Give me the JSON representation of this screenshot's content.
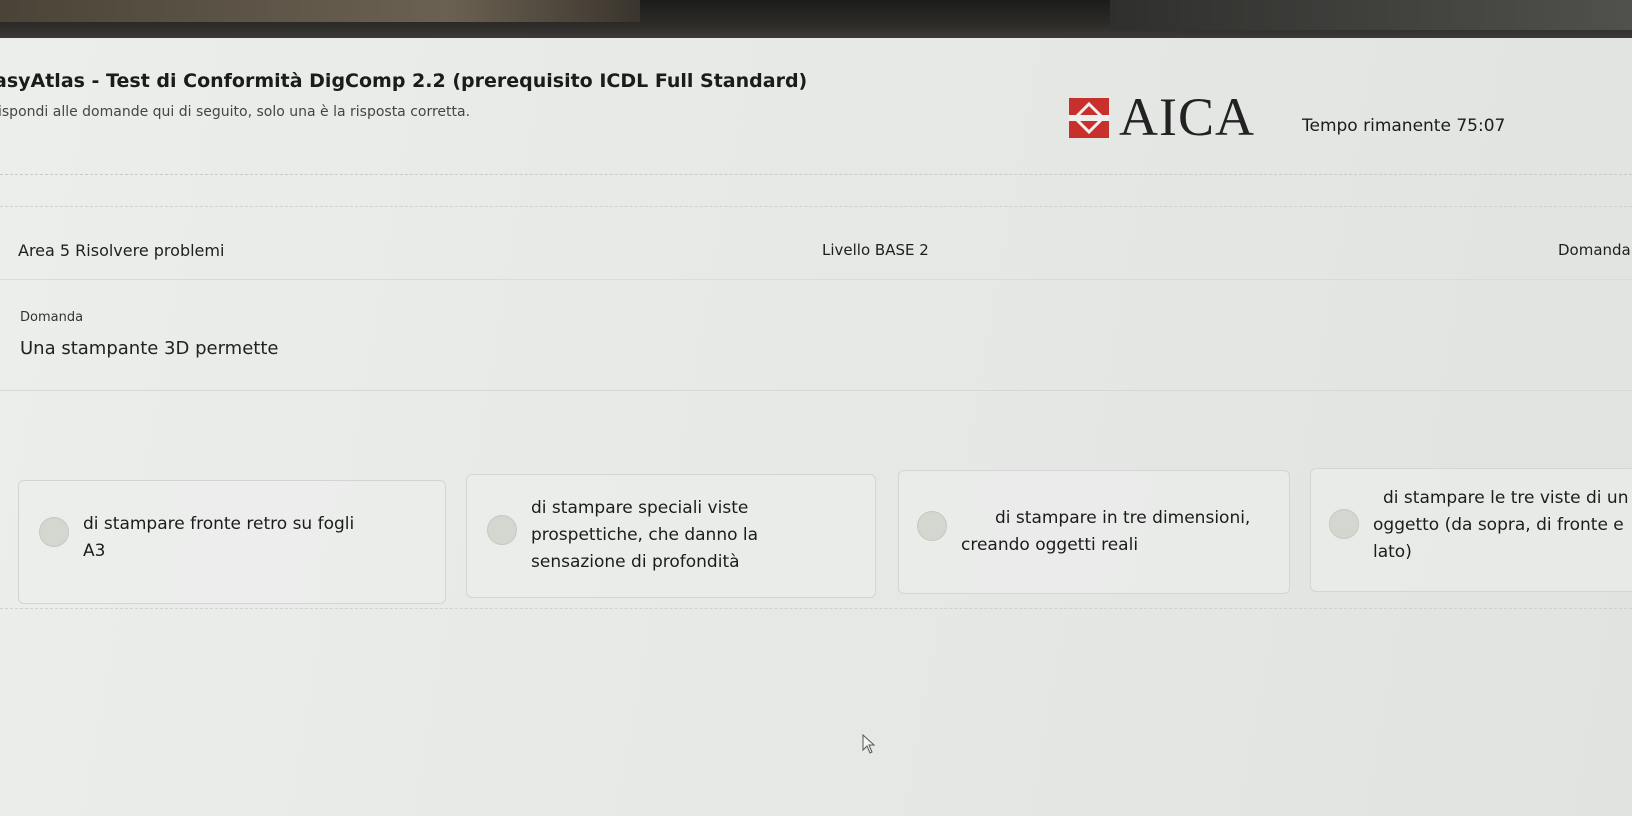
{
  "header": {
    "title": "asyAtlas - Test di Conformità DigComp 2.2 (prerequisito ICDL Full Standard)",
    "instructions": "ispondi alle domande qui di seguito, solo una è la risposta corretta.",
    "logo_text": "AICA",
    "timer_label": "Tempo rimanente",
    "timer_value": "75:07"
  },
  "info_bar": {
    "area": "Area 5 Risolvere problemi",
    "level": "Livello BASE 2",
    "question_counter": "Domanda"
  },
  "question": {
    "caption": "Domanda",
    "text": "Una stampante 3D permette"
  },
  "answers": [
    {
      "lines": [
        "di stampare fronte retro su fogli",
        "A3"
      ]
    },
    {
      "lines": [
        "di stampare speciali viste",
        "prospettiche, che danno la",
        "sensazione di profondità"
      ]
    },
    {
      "lines": [
        "di stampare in tre dimensioni,",
        "creando oggetti reali"
      ]
    },
    {
      "lines": [
        "di stampare le tre viste di un",
        "oggetto (da sopra, di fronte e",
        "lato)"
      ]
    }
  ],
  "colors": {
    "logo_red": "#c8312b",
    "radio": "#d4d6d0"
  },
  "icons": {
    "logo_mark": "aica-logo-icon",
    "cursor": "mouse-pointer-icon"
  }
}
